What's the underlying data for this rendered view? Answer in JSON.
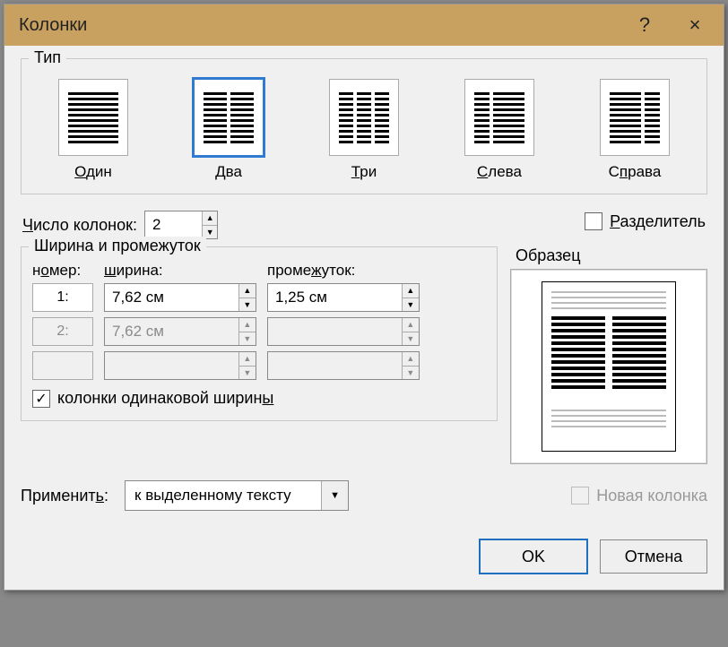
{
  "titlebar": {
    "title": "Колонки",
    "help": "?",
    "close": "×"
  },
  "type_group": {
    "legend": "Тип"
  },
  "presets": {
    "one": {
      "label": "Один"
    },
    "two": {
      "label": "Два",
      "selected": true
    },
    "three": {
      "label": "Три"
    },
    "left": {
      "label": "Слева"
    },
    "right": {
      "label": "Справа"
    }
  },
  "count": {
    "label": "Число колонок:",
    "value": "2"
  },
  "separator": {
    "label": "Разделитель",
    "checked": false
  },
  "width_spacing": {
    "legend": "Ширина и промежуток",
    "headers": {
      "num": "номер:",
      "width": "ширина:",
      "spacing": "промежуток:"
    },
    "rows": [
      {
        "num": "1:",
        "width": "7,62 см",
        "spacing": "1,25 см",
        "disabled": false
      },
      {
        "num": "2:",
        "width": "7,62 см",
        "spacing": "",
        "disabled": true
      },
      {
        "num": "",
        "width": "",
        "spacing": "",
        "disabled": true
      }
    ],
    "equal": {
      "label": "колонки одинаковой ширины",
      "checked": true
    }
  },
  "preview": {
    "legend": "Образец"
  },
  "apply": {
    "label": "Применить:",
    "value": "к выделенному тексту",
    "new_column": {
      "label": "Новая колонка",
      "checked": false,
      "disabled": true
    }
  },
  "buttons": {
    "ok": "OK",
    "cancel": "Отмена"
  }
}
